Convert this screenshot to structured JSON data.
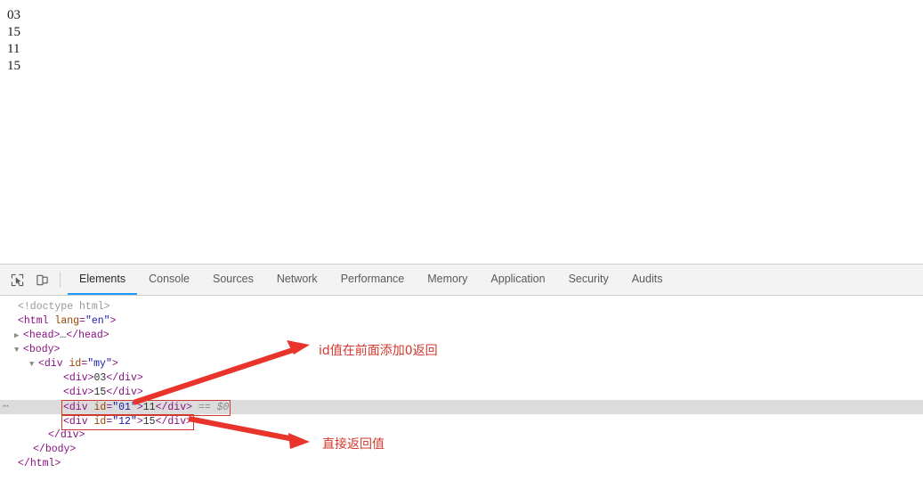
{
  "page": {
    "lines": [
      "03",
      "15",
      "11",
      "15"
    ]
  },
  "devtools": {
    "icons": [
      {
        "name": "inspect-element-icon",
        "title": "Inspect element"
      },
      {
        "name": "device-toolbar-icon",
        "title": "Toggle device toolbar"
      }
    ],
    "tabs": [
      {
        "label": "Elements",
        "active": true
      },
      {
        "label": "Console",
        "active": false
      },
      {
        "label": "Sources",
        "active": false
      },
      {
        "label": "Network",
        "active": false
      },
      {
        "label": "Performance",
        "active": false
      },
      {
        "label": "Memory",
        "active": false
      },
      {
        "label": "Application",
        "active": false
      },
      {
        "label": "Security",
        "active": false
      },
      {
        "label": "Audits",
        "active": false
      }
    ],
    "accent_color": "#1b9af7",
    "selection_color": "#dcdcdc",
    "highlight_box_color": "#cf3a30"
  },
  "dom": {
    "ellipsis_marker": "⋯",
    "rows": [
      {
        "indent": 0,
        "twisty": "",
        "text": "<!doctype html>"
      },
      {
        "indent": 0,
        "twisty": "",
        "text": "<html lang=\"en\">"
      },
      {
        "indent": 1,
        "twisty": "▶",
        "text": "<head>…</head>"
      },
      {
        "indent": 1,
        "twisty": "▼",
        "text": "<body>"
      },
      {
        "indent": 2,
        "twisty": "▼",
        "text": "<div id=\"my\">"
      },
      {
        "indent": 3,
        "twisty": "",
        "text": "<div>03</div>"
      },
      {
        "indent": 3,
        "twisty": "",
        "text": "<div>15</div>"
      },
      {
        "indent": 3,
        "twisty": "",
        "text": "<div id=\"01\">11</div> == $0"
      },
      {
        "indent": 3,
        "twisty": "",
        "text": "<div id=\"12\">15</div>"
      },
      {
        "indent": 2,
        "twisty": "",
        "text": "</div>"
      },
      {
        "indent": 1,
        "twisty": "",
        "text": "</body>"
      },
      {
        "indent": 0,
        "twisty": "",
        "text": "</html>"
      }
    ],
    "selected_row_text": "<div id=\"01\">11</div> == $0",
    "reference_label": "== $0"
  },
  "annotations": [
    {
      "text": "id值在前面添加0返回",
      "color": "#d0392e"
    },
    {
      "text": "直接返回值",
      "color": "#d0392e"
    }
  ]
}
